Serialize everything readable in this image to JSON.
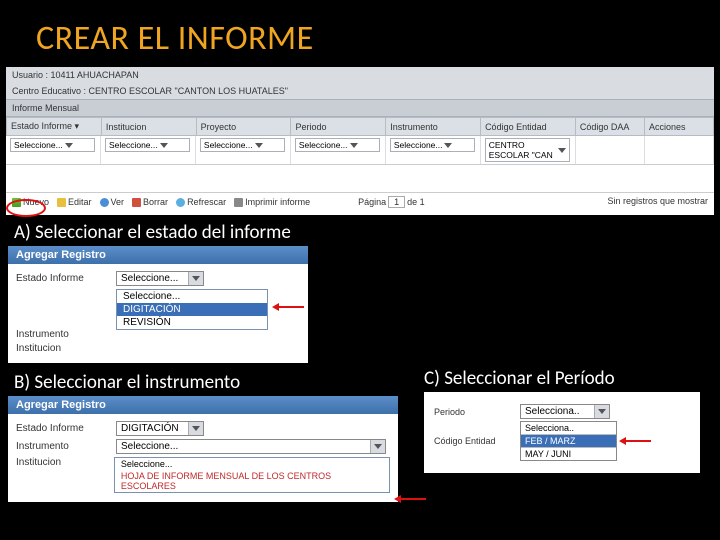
{
  "title": "CREAR EL INFORME",
  "top_panel": {
    "user_line": "Usuario : 10411 AHUACHAPAN",
    "center_line": "Centro Educativo : CENTRO ESCOLAR \"CANTON LOS HUATALES\"",
    "subtitle": "Informe Mensual",
    "filters": {
      "estado": "Estado Informe ▾",
      "institucion": "Institucion",
      "proyecto": "Proyecto",
      "periodo": "Periodo",
      "instrumento": "Instrumento",
      "codigo_entidad": "Código Entidad",
      "codigo_daa": "Código DAA",
      "acciones": "Acciones"
    },
    "select_placeholder": "Seleccione...",
    "entidad_value": "CENTRO ESCOLAR \"CAN",
    "toolbar": {
      "nuevo": "Nuevo",
      "editar": "Editar",
      "ver": "Ver",
      "borrar": "Borrar",
      "refrescar": "Refrescar",
      "imprimir": "Imprimir informe",
      "pagina_lbl": "Página",
      "pagina_val": "1",
      "pagina_of": "de 1",
      "no_records": "Sin registros que mostrar"
    }
  },
  "step_a": {
    "label": "A) Seleccionar el estado del informe",
    "dialog_title": "Agregar Registro",
    "fields": {
      "estado": "Estado Informe",
      "instrumento": "Instrumento",
      "institucion": "Institucion"
    },
    "selected": "Seleccione...",
    "options": {
      "o1": "Seleccione...",
      "o2": "DIGITACIÓN",
      "o3": "REVISIÓN"
    }
  },
  "step_b": {
    "label": "B) Seleccionar el instrumento",
    "dialog_title": "Agregar Registro",
    "fields": {
      "estado": "Estado Informe",
      "instrumento": "Instrumento",
      "institucion": "Institucion"
    },
    "estado_val": "DIGITACIÓN",
    "instr_val": "Seleccione...",
    "options": {
      "o1": "Seleccione...",
      "o2": "HOJA DE INFORME MENSUAL DE LOS CENTROS ESCOLARES"
    }
  },
  "step_c": {
    "label": "C) Seleccionar el Período",
    "fields": {
      "periodo": "Periodo",
      "codigo_entidad": "Código Entidad"
    },
    "sel": "Selecciona..",
    "options": {
      "o1": "Selecciona..",
      "o2": "FEB / MARZ",
      "o3": "MAY / JUNI"
    }
  }
}
